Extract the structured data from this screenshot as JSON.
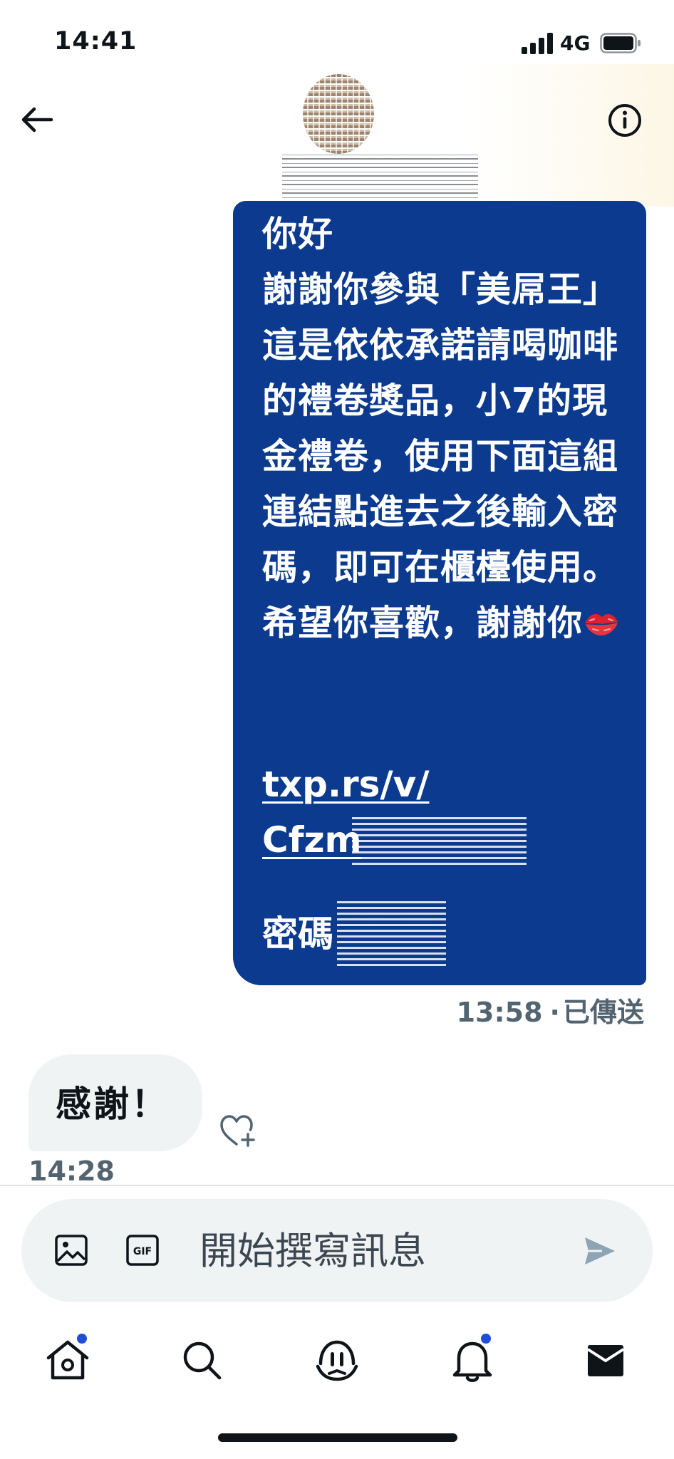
{
  "status_bar": {
    "time": "14:41",
    "network": "4G"
  },
  "header": {
    "back_icon": "arrow-left-icon",
    "info_icon": "info-icon"
  },
  "conversation": {
    "outgoing": {
      "text": "你好\n謝謝你參與「美屌王」這是依依承諾請喝咖啡的禮卷獎品，小7的現金禮卷，使用下面這組連結點進去之後輸入密碼，即可在櫃檯使用。希望你喜歡，謝謝你",
      "emoji": "kiss-mark-icon",
      "link": "txp.rs/v/\nCfzm",
      "password_label": "密碼",
      "time": "13:58",
      "status": "已傳送",
      "bubble_color": "#0b3a8e"
    },
    "incoming": {
      "text": "感謝！",
      "time": "14:28",
      "react_icon": "heart-plus-icon",
      "bubble_color": "#eff3f4"
    }
  },
  "composer": {
    "placeholder": "開始撰寫訊息",
    "image_icon": "image-icon",
    "gif_icon": "gif-icon",
    "send_icon": "send-icon"
  },
  "bottom_nav": {
    "items": [
      "home-icon",
      "search-icon",
      "spaces-icon",
      "notifications-icon",
      "messages-icon"
    ],
    "badge_color": "#1d4ed8"
  }
}
